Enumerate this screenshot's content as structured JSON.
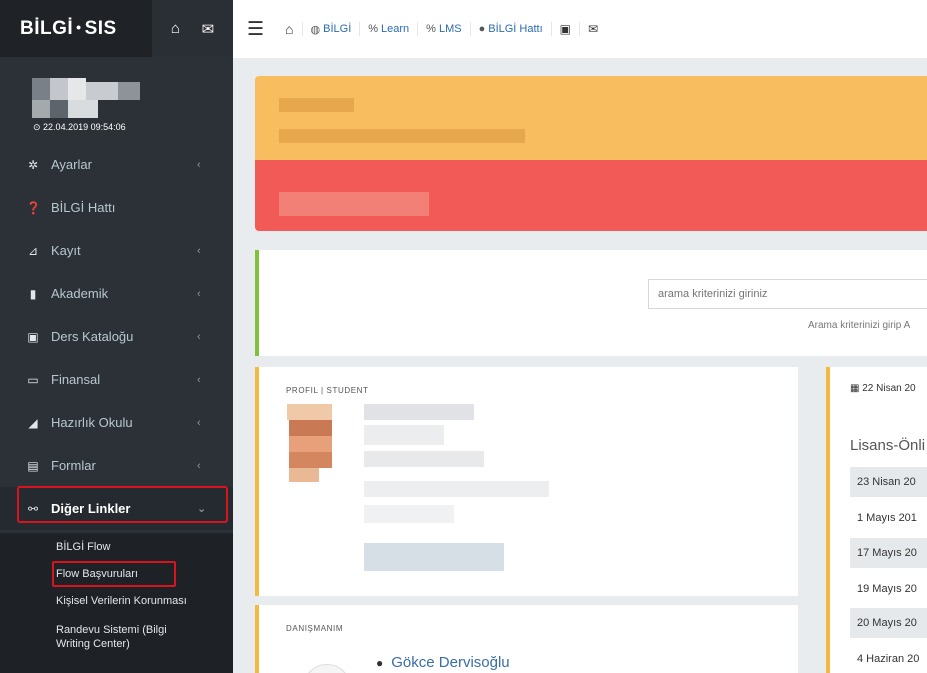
{
  "sidebar": {
    "brand_left": "BİLGİ",
    "brand_dot": "•",
    "brand_right": "SIS",
    "user_time": "22.04.2019 09:54:06",
    "menu": [
      {
        "label": "Ayarlar",
        "icon": "gear-icon",
        "glyph": "✲"
      },
      {
        "label": "BİLGİ Hattı",
        "icon": "question-circle-icon",
        "glyph": "❓"
      },
      {
        "label": "Kayıt",
        "icon": "chart-icon",
        "glyph": "⊿"
      },
      {
        "label": "Akademik",
        "icon": "book-icon",
        "glyph": "▮"
      },
      {
        "label": "Ders Kataloğu",
        "icon": "catalog-icon",
        "glyph": "▣"
      },
      {
        "label": "Finansal",
        "icon": "money-icon",
        "glyph": "▭"
      },
      {
        "label": "Hazırlık Okulu",
        "icon": "school-icon",
        "glyph": "◢"
      },
      {
        "label": "Formlar",
        "icon": "form-icon",
        "glyph": "▤"
      },
      {
        "label": "Diğer Linkler",
        "icon": "link-icon",
        "glyph": "⚯"
      }
    ],
    "submenu": [
      "BİLGİ Flow",
      "Flow Başvuruları",
      "Kişisel Verilerin Korunması",
      "Randevu Sistemi (Bilgi Writing Center)"
    ]
  },
  "topbar": {
    "links": [
      {
        "label": "BİLGİ",
        "icon": "globe-icon",
        "glyph": "◍"
      },
      {
        "label": "Learn",
        "icon": "link-icon",
        "glyph": "%"
      },
      {
        "label": "LMS",
        "icon": "link-icon",
        "glyph": "%"
      },
      {
        "label": "BİLGİ Hattı",
        "icon": "question-circle-icon",
        "glyph": "●"
      }
    ]
  },
  "search": {
    "placeholder": "arama kriterinizi giriniz",
    "hint": "Arama kriterinizi girip A"
  },
  "profile": {
    "label": "PROFIL | STUDENT"
  },
  "advisor": {
    "label": "DANIŞMANIM",
    "name": "Gökce Dervisoğlu"
  },
  "calendar": {
    "date": "22 Nisan 20",
    "title": "Lisans-Önli",
    "rows": [
      "23 Nisan 20",
      "1 Mayıs 201",
      "17 Mayıs 20",
      "19 Mayıs 20",
      "20 Mayıs 20",
      "4 Haziran 20"
    ]
  }
}
